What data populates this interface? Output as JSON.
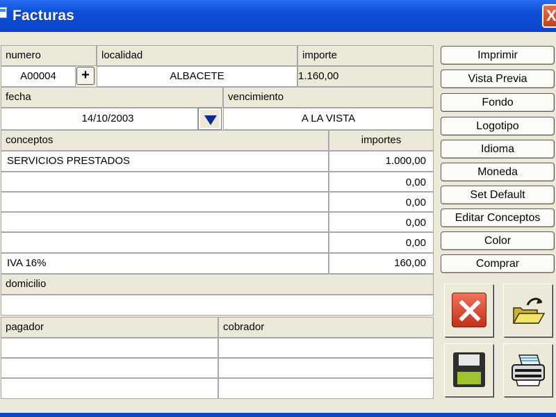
{
  "window": {
    "title": "Facturas",
    "close_glyph": "X"
  },
  "invoice": {
    "numero_label": "numero",
    "numero": "A00004",
    "localidad_label": "localidad",
    "localidad": "ALBACETE",
    "importe_label": "importe",
    "importe": "1.160,00",
    "fecha_label": "fecha",
    "fecha": "14/10/2003",
    "vencimiento_label": "vencimiento",
    "vencimiento": "A LA VISTA",
    "conceptos_label": "conceptos",
    "importes_label": "importes",
    "rows": [
      {
        "concepto": "SERVICIOS PRESTADOS",
        "importe": "1.000,00"
      },
      {
        "concepto": "",
        "importe": "0,00"
      },
      {
        "concepto": "",
        "importe": "0,00"
      },
      {
        "concepto": "",
        "importe": "0,00"
      },
      {
        "concepto": "",
        "importe": "0,00"
      }
    ],
    "iva_label": "IVA 16%",
    "iva": "160,00",
    "domicilio_label": "domicilio",
    "domicilio": "",
    "pagador_label": "pagador",
    "cobrador_label": "cobrador",
    "pagador_lines": [
      "",
      "",
      ""
    ],
    "cobrador_lines": [
      "",
      "",
      ""
    ],
    "plus_glyph": "+"
  },
  "sidebar": {
    "buttons": [
      "Imprimir",
      "Vista Previa",
      "Fondo",
      "Logotipo",
      "Idioma",
      "Moneda",
      "Set Default",
      "Editar Conceptos",
      "Color",
      "Comprar"
    ]
  },
  "actions": {
    "icons": [
      "cancel-icon",
      "open-folder-icon",
      "save-disk-icon",
      "printer-icon"
    ]
  }
}
